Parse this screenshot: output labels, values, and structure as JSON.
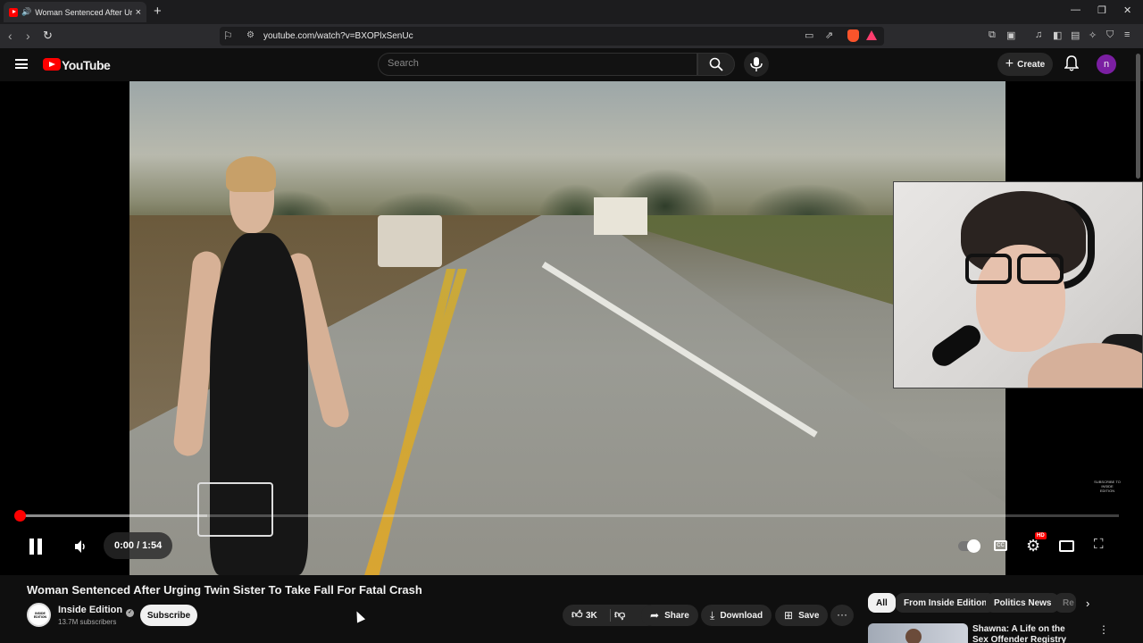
{
  "browser": {
    "tab_title": "Woman Sentenced After Urging Twin Sister To Take Fall For Fatal Crash",
    "new_tab": "+",
    "url": "youtube.com/watch?v=BXOPlxSenUc",
    "window_controls": [
      "—",
      "❐",
      "✕"
    ]
  },
  "header": {
    "logo_text": "YouTube",
    "search_placeholder": "Search",
    "create_label": "Create",
    "avatar_letter": "n"
  },
  "player": {
    "time": "0:00 / 1:54",
    "progress_fraction": 0.0,
    "quality_badge": "HD",
    "watermark": "SUBSCRIBE TO INSIDE EDITION"
  },
  "video": {
    "title": "Woman Sentenced After Urging Twin Sister To Take Fall For Fatal Crash",
    "channel_name": "Inside Edition",
    "subscribers": "13.7M subscribers",
    "subscribe_label": "Subscribe",
    "likes": "3K",
    "share_label": "Share",
    "download_label": "Download",
    "save_label": "Save"
  },
  "sidebar": {
    "chips": [
      "All",
      "From Inside Edition",
      "Politics News",
      "Re"
    ],
    "active_chip": "All",
    "rec_title": "Shawna: A Life on the Sex Offender Registry"
  },
  "colors": {
    "brand_red": "#ff0000",
    "background": "#0f0f0f",
    "avatar": "#7b1fa2"
  }
}
